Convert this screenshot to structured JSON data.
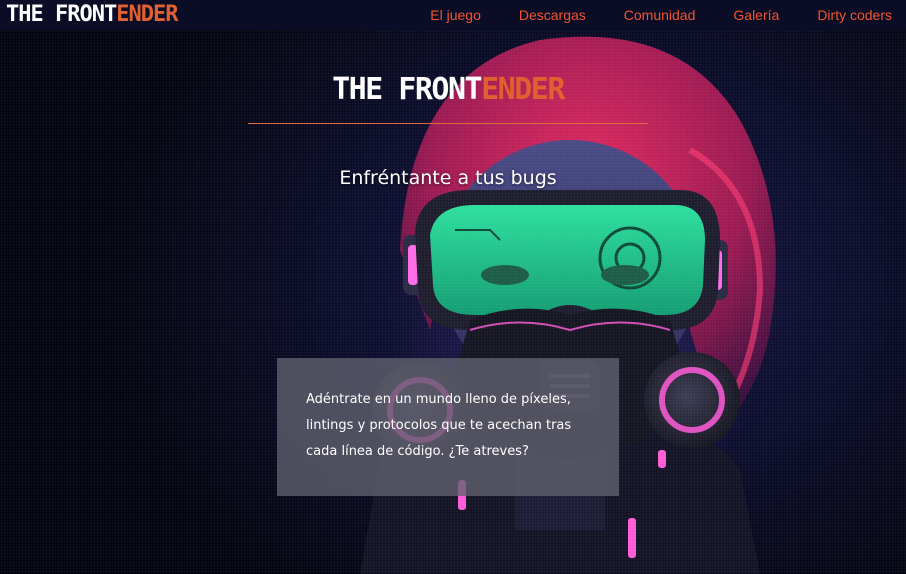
{
  "header": {
    "brand": {
      "part1": "THE FRONT",
      "part2": "ENDER"
    },
    "nav": [
      {
        "label": "El juego"
      },
      {
        "label": "Descargas"
      },
      {
        "label": "Comunidad"
      },
      {
        "label": "Galería"
      },
      {
        "label": "Dirty coders"
      }
    ]
  },
  "hero": {
    "title": {
      "part1": "THE FRONT",
      "part2": "ENDER"
    },
    "subtitle": "Enfréntante a tus bugs",
    "intro": "Adéntrate en un mundo lleno de píxeles, lintings y protocolos que te acechan tras cada línea de código. ¿Te atreves?"
  },
  "colors": {
    "accent": "#f0552e",
    "navbar": "#0b0c26",
    "background": "#07091f",
    "goggle_green": "#1fe39a",
    "neon_pink": "#ff5bd8",
    "hair_red": "#d2245a"
  }
}
